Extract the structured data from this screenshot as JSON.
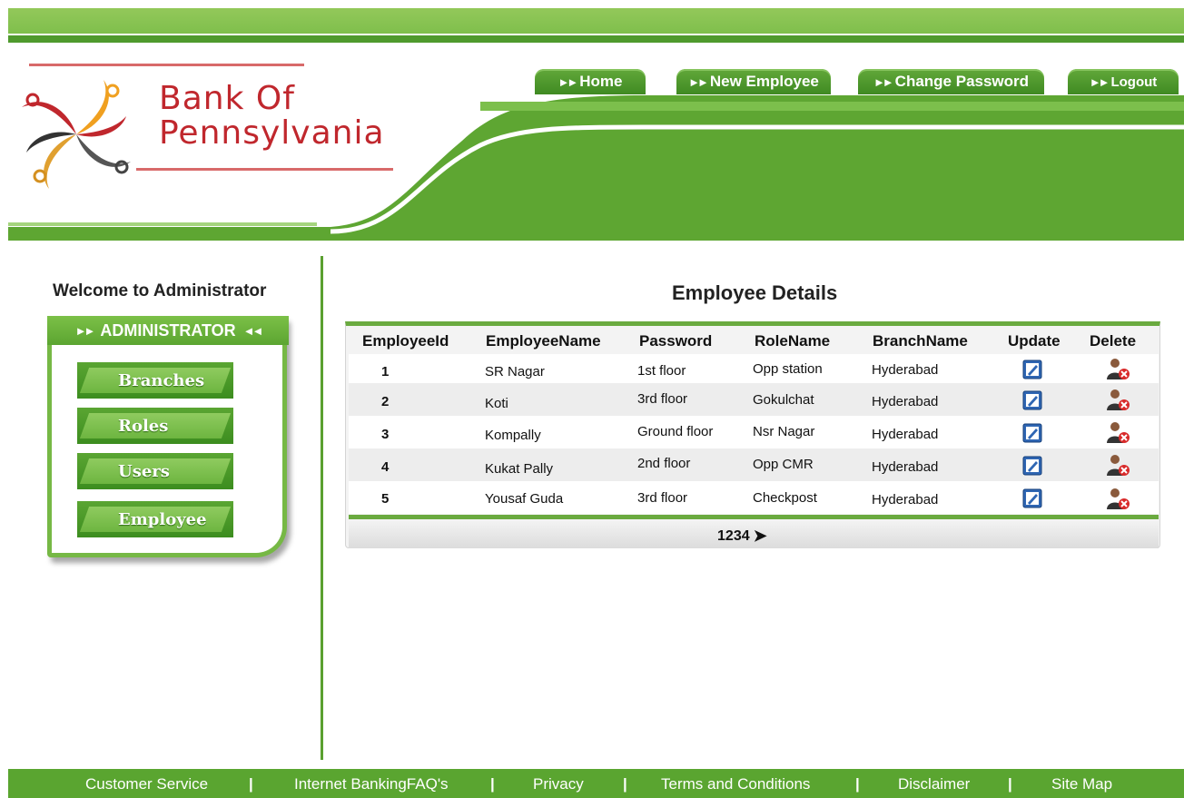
{
  "brand": {
    "line1": "Bank Of",
    "line2": "Pennsylvania"
  },
  "nav": {
    "home": "Home",
    "new_employee": "New Employee",
    "change_password": "Change Password",
    "logout": "Logout"
  },
  "sidebar": {
    "welcome": "Welcome to Administrator",
    "heading": "ADMINISTRATOR",
    "items": [
      "Branches",
      "Roles",
      "Users",
      "Employee"
    ]
  },
  "main": {
    "title": "Employee Details",
    "columns": [
      "EmployeeId",
      "EmployeeName",
      "Password",
      "RoleName",
      "BranchName",
      "Update",
      "Delete"
    ],
    "rows": [
      {
        "id": "1",
        "name": "SR Nagar",
        "password": "1st floor",
        "role": "Opp station",
        "branch": "Hyderabad"
      },
      {
        "id": "2",
        "name": "Koti",
        "password": "3rd floor",
        "role": "Gokulchat",
        "branch": "Hyderabad"
      },
      {
        "id": "3",
        "name": "Kompally",
        "password": "Ground floor",
        "role": "Nsr Nagar",
        "branch": "Hyderabad"
      },
      {
        "id": "4",
        "name": "Kukat Pally",
        "password": "2nd floor",
        "role": "Opp CMR",
        "branch": "Hyderabad"
      },
      {
        "id": "5",
        "name": "Yousaf Guda",
        "password": "3rd floor",
        "role": "Checkpost",
        "branch": "Hyderabad"
      }
    ],
    "pager": [
      "1",
      "2",
      "3",
      "4"
    ]
  },
  "footer": {
    "links": [
      "Customer Service",
      "Internet BankingFAQ's",
      "Privacy",
      "Terms and Conditions",
      "Disclaimer",
      "Site Map"
    ],
    "separator": "|"
  },
  "colors": {
    "brand_green": "#5aa530",
    "accent_red": "#c0272d",
    "light_green": "#8bc34a"
  },
  "icons": {
    "update": "edit-icon",
    "delete": "delete-user-icon",
    "next": "next-arrow-icon"
  }
}
